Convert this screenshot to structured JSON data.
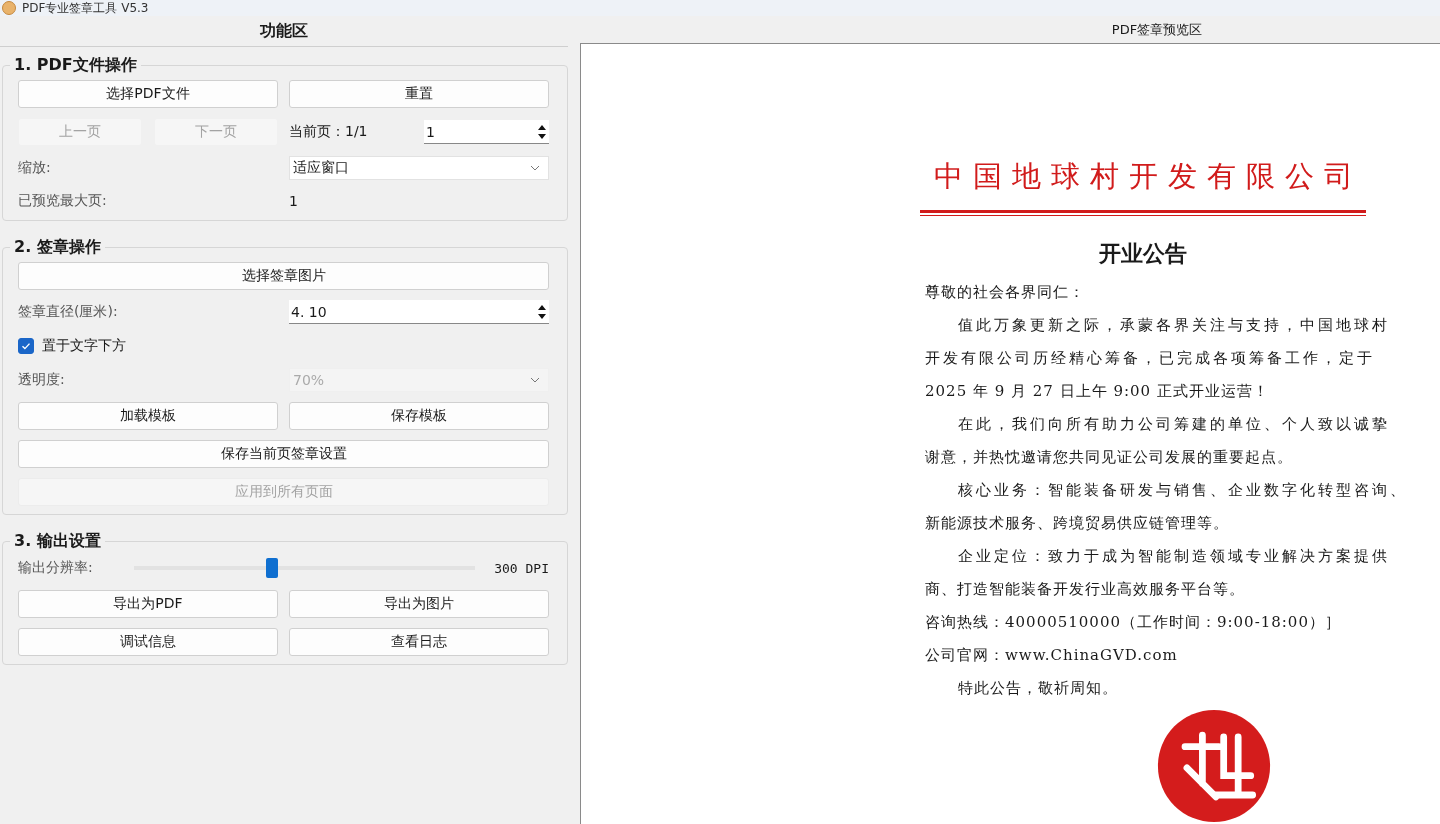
{
  "window": {
    "title": "PDF专业签章工具 V5.3"
  },
  "left_panel": {
    "title": "功能区",
    "sections": [
      {
        "title": "1. PDF文件操作",
        "rows": [
          {
            "kind": "buttons",
            "items": [
              {
                "label": "选择PDF文件",
                "disabled": false
              },
              {
                "label": "重置",
                "disabled": false
              }
            ]
          },
          {
            "kind": "pager",
            "items": [
              {
                "label": "上一页",
                "disabled": true
              },
              {
                "label": "下一页",
                "disabled": true
              }
            ],
            "label": "当前页：1/1",
            "value": "1"
          },
          {
            "kind": "combo",
            "label": "缩放:",
            "value": "适应窗口",
            "disabled": false
          },
          {
            "kind": "info",
            "label": "已预览最大页:",
            "value": "1"
          }
        ]
      },
      {
        "title": "2. 签章操作",
        "rows": [
          {
            "kind": "buttons",
            "items": [
              {
                "label": "选择签章图片",
                "disabled": false
              }
            ]
          },
          {
            "kind": "spin",
            "label": "签章直径(厘米):",
            "value": "4. 10"
          },
          {
            "kind": "checkbox",
            "label": "置于文字下方",
            "checked": true
          },
          {
            "kind": "combo",
            "label": "透明度:",
            "value": "70%",
            "disabled": true
          },
          {
            "kind": "buttons",
            "items": [
              {
                "label": "加载模板",
                "disabled": false
              },
              {
                "label": "保存模板",
                "disabled": false
              }
            ]
          },
          {
            "kind": "buttons",
            "items": [
              {
                "label": "保存当前页签章设置",
                "disabled": false
              }
            ]
          },
          {
            "kind": "buttons",
            "items": [
              {
                "label": "应用到所有页面",
                "disabled": true
              }
            ]
          }
        ]
      },
      {
        "title": "3. 输出设置",
        "rows": [
          {
            "kind": "slider",
            "label": "输出分辨率:",
            "level": 0.405,
            "reading": "300 DPI"
          },
          {
            "kind": "buttons",
            "items": [
              {
                "label": "导出为PDF",
                "disabled": false
              },
              {
                "label": "导出为图片",
                "disabled": false
              }
            ]
          },
          {
            "kind": "buttons",
            "items": [
              {
                "label": "调试信息",
                "disabled": false
              },
              {
                "label": "查看日志",
                "disabled": false
              }
            ]
          }
        ]
      }
    ]
  },
  "preview": {
    "title": "PDF签章预览区",
    "document": {
      "company": "中国地球村开发有限公司",
      "heading": "开业公告",
      "lines": [
        {
          "text": "尊敬的社会各界同仁：",
          "indent": false,
          "justified": false
        },
        {
          "text": "值此万象更新之际，承蒙各界关注与支持，中国地球村",
          "indent": true,
          "justified": true
        },
        {
          "text": "开发有限公司历经精心筹备，已完成各项筹备工作，定于",
          "indent": false,
          "justified": true
        },
        {
          "text": "2025 年 9 月 27 日上午 9:00 正式开业运营！",
          "indent": false,
          "justified": false
        },
        {
          "text": "在此，我们向所有助力公司筹建的单位、个人致以诚挚",
          "indent": true,
          "justified": true
        },
        {
          "text": "谢意，并热忱邀请您共同见证公司发展的重要起点。",
          "indent": false,
          "justified": false
        },
        {
          "text": "核心业务：智能装备研发与销售、企业数字化转型咨询、",
          "indent": true,
          "justified": true
        },
        {
          "text": "新能源技术服务、跨境贸易供应链管理等。",
          "indent": false,
          "justified": false
        },
        {
          "text": "企业定位：致力于成为智能制造领域专业解决方案提供",
          "indent": true,
          "justified": true
        },
        {
          "text": "商、打造智能装备开发行业高效服务平台等。",
          "indent": false,
          "justified": false
        },
        {
          "text": "咨询热线：40000510000（工作时间：9:00-18:00）］",
          "indent": false,
          "justified": false
        },
        {
          "text": "公司官网：www.ChinaGVD.com",
          "indent": false,
          "justified": false
        },
        {
          "text": "特此公告，敬祈周知。",
          "indent": true,
          "justified": false
        }
      ]
    }
  }
}
